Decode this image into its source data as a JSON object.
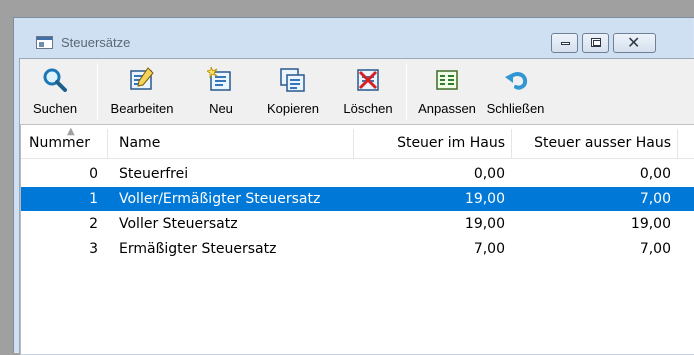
{
  "window": {
    "title": "Steuersätze"
  },
  "toolbar": {
    "search_label": "Suchen",
    "edit_label": "Bearbeiten",
    "new_label": "Neu",
    "copy_label": "Kopieren",
    "delete_label": "Löschen",
    "customize_label": "Anpassen",
    "close_label": "Schließen"
  },
  "list": {
    "headers": {
      "number": "Nummer",
      "name": "Name",
      "tax_in": "Steuer im Haus",
      "tax_out": "Steuer ausser Haus"
    },
    "rows": [
      {
        "number": "0",
        "name": "Steuerfrei",
        "tax_in": "0,00",
        "tax_out": "0,00"
      },
      {
        "number": "1",
        "name": "Voller/Ermäßigter Steuersatz",
        "tax_in": "19,00",
        "tax_out": "7,00"
      },
      {
        "number": "2",
        "name": "Voller Steuersatz",
        "tax_in": "19,00",
        "tax_out": "19,00"
      },
      {
        "number": "3",
        "name": "Ermäßigter Steuersatz",
        "tax_in": "7,00",
        "tax_out": "7,00"
      }
    ],
    "selected_index": 1,
    "sort_indicator": "▲"
  },
  "colors": {
    "selection": "#0078d7",
    "title_bg": "#cfe0f2"
  }
}
